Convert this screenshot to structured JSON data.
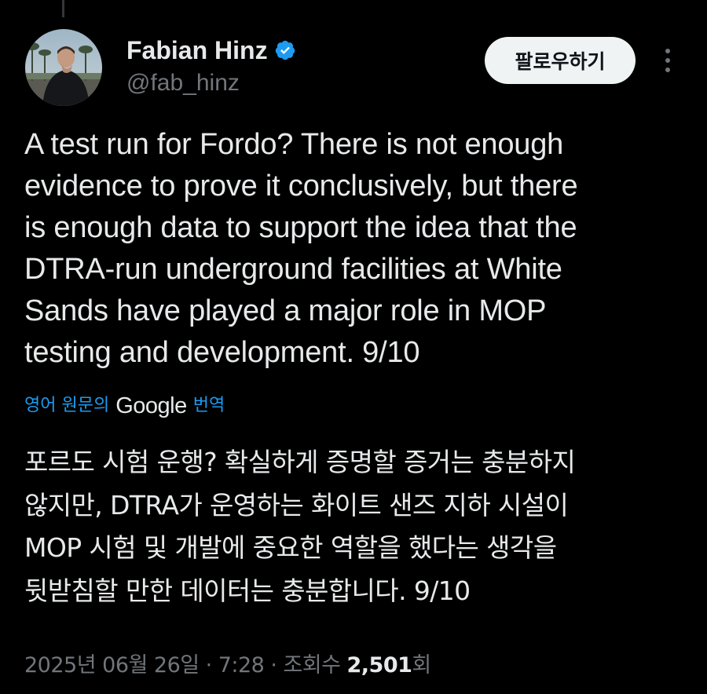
{
  "author": {
    "name": "Fabian Hinz",
    "handle": "@fab_hinz",
    "verified_color": "#1d9bf0",
    "avatar_icon": "profile-photo"
  },
  "actions": {
    "follow_label": "팔로우하기",
    "more_icon": "more-vertical-icon"
  },
  "tweet": {
    "text": "A test run for Fordo? There is not enough\nevidence to prove it conclusively, but there\nis enough data to support the idea that the\nDTRA-run underground facilities at White\nSands have played a major role in MOP\ntesting and development. 9/10"
  },
  "translation": {
    "prefix": "영어 원문의",
    "provider": "Google",
    "suffix": "번역",
    "text": "포르도 시험 운행? 확실하게 증명할 증거는 충분하지\n않지만, DTRA가 운영하는 화이트 샌즈 지하 시설이\nMOP 시험 및 개발에 중요한 역할을 했다는 생각을\n뒷받침할 만한 데이터는 충분합니다. 9/10"
  },
  "meta": {
    "date": "2025년 06월 26일",
    "separator": "·",
    "time": "7:28",
    "views_label": "조회수",
    "views_count": "2,501",
    "views_suffix": "회"
  },
  "colors": {
    "background": "#000000",
    "text": "#e7e9ea",
    "muted": "#71767b",
    "accent": "#1d9bf0"
  }
}
